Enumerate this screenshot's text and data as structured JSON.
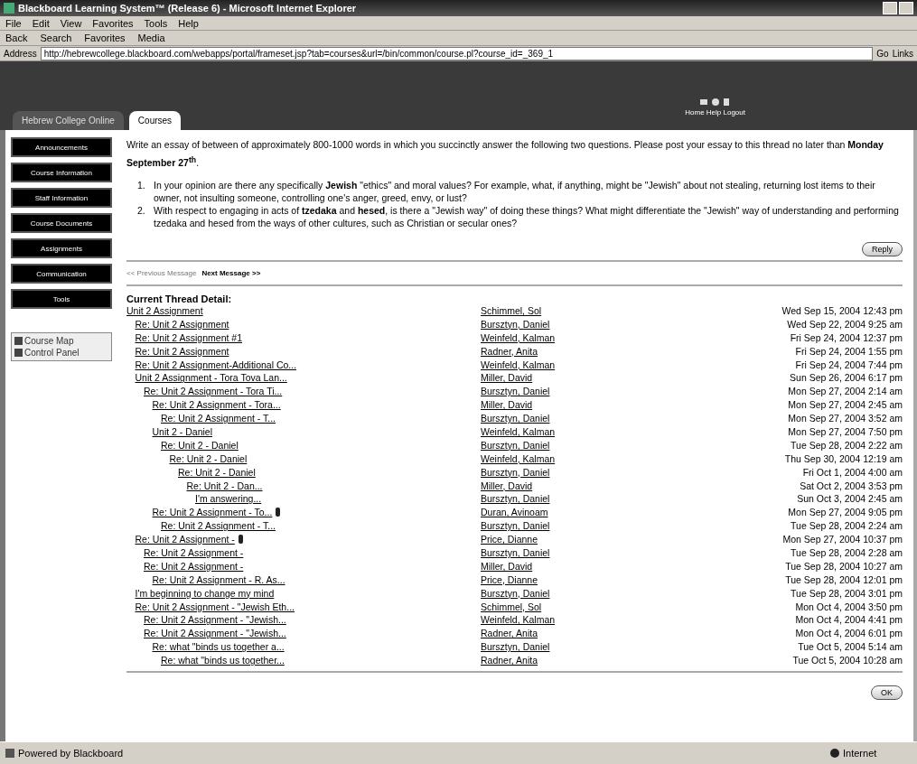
{
  "window": {
    "title": "Blackboard Learning System™ (Release 6) - Microsoft Internet Explorer"
  },
  "menu": [
    "File",
    "Edit",
    "View",
    "Favorites",
    "Tools",
    "Help"
  ],
  "toolbar": [
    "Back",
    "Search",
    "Favorites",
    "Media"
  ],
  "address": {
    "label": "Address",
    "value": "http://hebrewcollege.blackboard.com/webapps/portal/frameset.jsp?tab=courses&url=/bin/common/course.pl?course_id=_369_1",
    "go": "Go",
    "links": "Links"
  },
  "tabs": [
    {
      "label": "Hebrew College Online",
      "selected": false
    },
    {
      "label": "Courses",
      "selected": true
    }
  ],
  "header_links": "Home Help Logout",
  "sidebar": {
    "buttons": [
      "Announcements",
      "Course Information",
      "Staff Information",
      "Course Documents",
      "Assignments",
      "Communication",
      "Tools"
    ],
    "tools": [
      "Course Map",
      "Control Panel"
    ]
  },
  "message": {
    "intro": "Write an essay of between of approximately 800-1000 words in which you succinctly answer the following two questions. Please post your essay to this thread no later than **Monday September 27$^{th}$**.",
    "questions": [
      {
        "number": "1.",
        "text": "In your opinion are there any specifically **Jewish** \"ethics\" and moral values? For example, what, if anything, might be \"Jewish\" about not stealing, returning lost items to their owner, not insulting someone, controlling one's anger, greed, envy, or lust?"
      },
      {
        "number": "2.",
        "text": "With respect to engaging in acts of **tzedaka** and **hesed**, is there a \"Jewish way\" of doing these things? What might differentiate the \"Jewish\" way of understanding and performing tzedaka and hesed from the ways of other cultures, such as Christian or secular ones?"
      }
    ],
    "reply": "Reply"
  },
  "nav": {
    "previous": "<< Previous Message",
    "next": "Next Message >>"
  },
  "thread": {
    "heading": "Current Thread Detail:",
    "posts": [
      {
        "subject": "Unit 2 Assignment",
        "author": "Schimmel, Sol",
        "date": "Wed Sep 15, 2004 12:43 pm",
        "children": [
          {
            "subject": "Re: Unit 2 Assignment",
            "author": "Bursztyn, Daniel",
            "date": "Wed Sep 22, 2004 9:25 am"
          },
          {
            "subject": "Re: Unit 2 Assignment #1",
            "author": "Weinfeld, Kalman",
            "date": "Fri Sep 24, 2004 12:37 pm"
          },
          {
            "subject": "Re: Unit 2 Assignment",
            "author": "Radner, Anita",
            "date": "Fri Sep 24, 2004 1:55 pm"
          },
          {
            "subject": "Re: Unit 2 Assignment-Additional Co...",
            "author": "Weinfeld, Kalman",
            "date": "Fri Sep 24, 2004 7:44 pm"
          },
          {
            "subject": "Unit 2 Assignment - Tora Tova Lan...",
            "author": "Miller, David",
            "date": "Sun Sep 26, 2004 6:17 pm",
            "children": [
              {
                "subject": "Re: Unit 2 Assignment - Tora Ti...",
                "author": "Bursztyn, Daniel",
                "date": "Mon Sep 27, 2004 2:14 am",
                "children": [
                  {
                    "subject": "Re: Unit 2 Assignment - Tora...",
                    "author": "Miller, David",
                    "date": "Mon Sep 27, 2004 2:45 am",
                    "children": [
                      {
                        "subject": "Re: Unit 2 Assignment - T...",
                        "author": "Bursztyn, Daniel",
                        "date": "Mon Sep 27, 2004 3:52 am"
                      }
                    ]
                  },
                  {
                    "subject": "Unit 2 - Daniel",
                    "author": "Weinfeld, Kalman",
                    "date": "Mon Sep 27, 2004 7:50 pm",
                    "children": [
                      {
                        "subject": "Re: Unit 2 - Daniel",
                        "author": "Bursztyn, Daniel",
                        "date": "Tue Sep 28, 2004 2:22 am",
                        "children": [
                          {
                            "subject": "Re: Unit 2 - Daniel",
                            "author": "Weinfeld, Kalman",
                            "date": "Thu Sep 30, 2004 12:19 am",
                            "children": [
                              {
                                "subject": "Re: Unit 2 - Daniel",
                                "author": "Bursztyn, Daniel",
                                "date": "Fri Oct 1, 2004 4:00 am",
                                "children": [
                                  {
                                    "subject": "Re: Unit 2 - Dan...",
                                    "author": "Miller, David",
                                    "date": "Sat Oct 2, 2004 3:53 pm",
                                    "children": [
                                      {
                                        "subject": "I'm answering...",
                                        "author": "Bursztyn, Daniel",
                                        "date": "Sun Oct 3, 2004 2:45 am"
                                      }
                                    ]
                                  }
                                ]
                              }
                            ]
                          }
                        ]
                      }
                    ]
                  },
                  {
                    "subject": "Re: Unit 2 Assignment - To...",
                    "author": "Duran, Avinoam",
                    "date": "Mon Sep 27, 2004 9:05 pm",
                    "attachment": true,
                    "children": [
                      {
                        "subject": "Re: Unit 2 Assignment - T...",
                        "author": "Bursztyn, Daniel",
                        "date": "Tue Sep 28, 2004 2:24 am"
                      }
                    ]
                  }
                ]
              }
            ]
          },
          {
            "subject": "Re: Unit 2 Assignment -",
            "author": "Price, Dianne",
            "date": "Mon Sep 27, 2004 10:37 pm",
            "attachment": true,
            "children": [
              {
                "subject": "Re: Unit 2 Assignment -",
                "author": "Bursztyn, Daniel",
                "date": "Tue Sep 28, 2004 2:28 am"
              },
              {
                "subject": "Re: Unit 2 Assignment -",
                "author": "Miller, David",
                "date": "Tue Sep 28, 2004 10:27 am",
                "children": [
                  {
                    "subject": "Re: Unit 2 Assignment - R. As...",
                    "author": "Price, Dianne",
                    "date": "Tue Sep 28, 2004 12:01 pm"
                  }
                ]
              }
            ]
          },
          {
            "subject": "I'm beginning to change my mind",
            "author": "Bursztyn, Daniel",
            "date": "Tue Sep 28, 2004 3:01 pm"
          },
          {
            "subject": "Re: Unit 2 Assignment - \"Jewish Eth...",
            "author": "Schimmel, Sol",
            "date": "Mon Oct 4, 2004 3:50 pm",
            "children": [
              {
                "subject": "Re: Unit 2 Assignment - \"Jewish...",
                "author": "Weinfeld, Kalman",
                "date": "Mon Oct 4, 2004 4:41 pm"
              },
              {
                "subject": "Re: Unit 2 Assignment - \"Jewish...",
                "author": "Radner, Anita",
                "date": "Mon Oct 4, 2004 6:01 pm",
                "children": [
                  {
                    "subject": "Re: what \"binds us together a...",
                    "author": "Bursztyn, Daniel",
                    "date": "Tue Oct 5, 2004 5:14 am",
                    "children": [
                      {
                        "subject": "Re: what \"binds us together...",
                        "author": "Radner, Anita",
                        "date": "Tue Oct 5, 2004 10:28 am"
                      }
                    ]
                  }
                ]
              }
            ]
          }
        ]
      }
    ]
  },
  "ok": "OK",
  "status_bar": {
    "text": "Powered by Blackboard",
    "zone": "Internet"
  }
}
